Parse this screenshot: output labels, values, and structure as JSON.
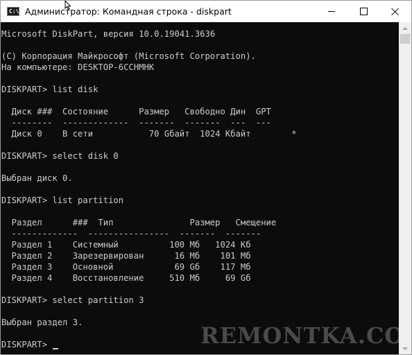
{
  "window": {
    "title": "Администратор: Командная строка - diskpart",
    "icon_label": "C:\\."
  },
  "console": {
    "lines": [
      "Microsoft DiskPart, версия 10.0.19041.3636",
      "",
      "(C) Корпорация Майкрософт (Microsoft Corporation).",
      "На компьютере: DESKTOP-6CCHMHK",
      "",
      "DISKPART> list disk",
      "",
      "  Диск ###  Состояние      Размер   Свободно Дин  GPT",
      "  --------  -------------  -------  -------  ---  ---",
      "  Диск 0    В сети           70 Gбайт  1024 Кбайт        *",
      "",
      "DISKPART> select disk 0",
      "",
      "Выбран диск 0.",
      "",
      "DISKPART> list partition",
      "",
      "  Раздел      ###  Тип               Размер   Смещение",
      "  -------------  ----------------  -------  -------",
      "  Раздел 1    Системный          100 Мб   1024 Кб",
      "  Раздел 2    Зарезервирован      16 Мб    101 Мб",
      "  Раздел 3    Основной            69 Gб    117 Мб",
      "  Раздел 4    Восстановление     510 Мб     69 Gб",
      "",
      "DISKPART> select partition 3",
      "",
      "Выбран раздел 3.",
      "",
      "DISKPART> "
    ]
  },
  "watermark": "REMONTKA.COM",
  "colors": {
    "console_bg": "#0c0c0c",
    "console_fg": "#cccccc",
    "titlebar_bg": "#ffffff"
  }
}
